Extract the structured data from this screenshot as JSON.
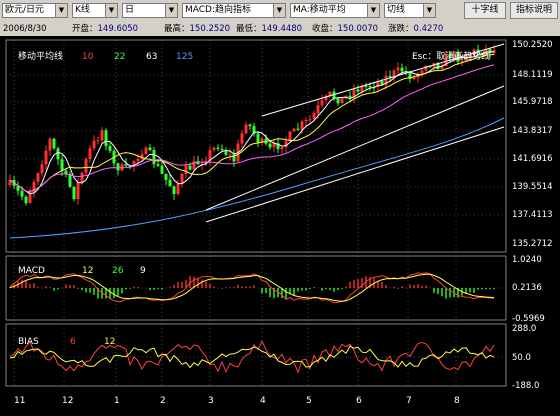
{
  "toolbar": {
    "symbol": "欧元/日元",
    "chart_type": "K线",
    "period": "日",
    "indicator_group": "MACD:趋向指标",
    "ma_indicator": "MA:移动平均",
    "split_mode": "切线",
    "crosshair_button": "十字线",
    "help_button": "指标说明"
  },
  "quote": {
    "date": "2006/8/30",
    "open_label": "开盘：",
    "open": "149.6050",
    "high_label": "最高：",
    "high": "150.2520",
    "low_label": "最低：",
    "low": "149.4480",
    "close_label": "收盘：",
    "close": "150.0070",
    "change_label": "涨跌：",
    "change": "0.4270"
  },
  "nav": {
    "zoom_in": "↑大",
    "zoom_out": "↓小",
    "left": "←左",
    "right": "→右"
  },
  "main_panel": {
    "title": "移动平均线",
    "ma_periods": [
      "10",
      "22",
      "63",
      "125"
    ],
    "esc_hint": "Esc：取消画趋势线",
    "y_ticks": [
      "150.2520",
      "148.1119",
      "145.9718",
      "143.8317",
      "141.6916",
      "139.5514",
      "137.4113",
      "135.2712"
    ]
  },
  "macd_panel": {
    "title": "MACD",
    "params": [
      "12",
      "26",
      "9"
    ],
    "y_ticks": [
      "1.0240",
      "0.2136",
      "-0.5969"
    ]
  },
  "bias_panel": {
    "title": "BIAS",
    "params": [
      "6",
      "12"
    ],
    "y_ticks": [
      "288.0",
      "50.0",
      "-188.0"
    ]
  },
  "x_axis": {
    "months": [
      "11",
      "12",
      "1",
      "2",
      "3",
      "4",
      "5",
      "6",
      "7",
      "8"
    ]
  },
  "colors": {
    "up": "#ff3030",
    "down": "#30ff30",
    "ma10": "#ffffff",
    "ma22": "#ffff40",
    "ma63": "#ff60ff",
    "ma125": "#4f9fff",
    "trendline": "#ffffff",
    "grid": "#404040"
  }
}
